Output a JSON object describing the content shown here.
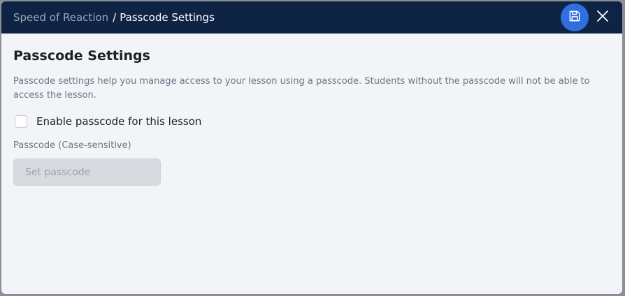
{
  "header": {
    "breadcrumb_parent": "Speed of Reaction",
    "breadcrumb_separator": "/",
    "breadcrumb_current": "Passcode Settings",
    "save_icon": "save-icon",
    "close_icon": "close-icon",
    "background_color": "#0f2344",
    "save_button_color": "#2f6fe0"
  },
  "main": {
    "title": "Passcode Settings",
    "description": "Passcode settings help you manage access to your lesson using a passcode. Students without the passcode will not be able to access the lesson.",
    "enable_checkbox": {
      "label": "Enable passcode for this lesson",
      "checked": false
    },
    "passcode_field": {
      "label": "Passcode (Case-sensitive)",
      "value": "",
      "placeholder": "Set passcode",
      "disabled": true
    }
  }
}
